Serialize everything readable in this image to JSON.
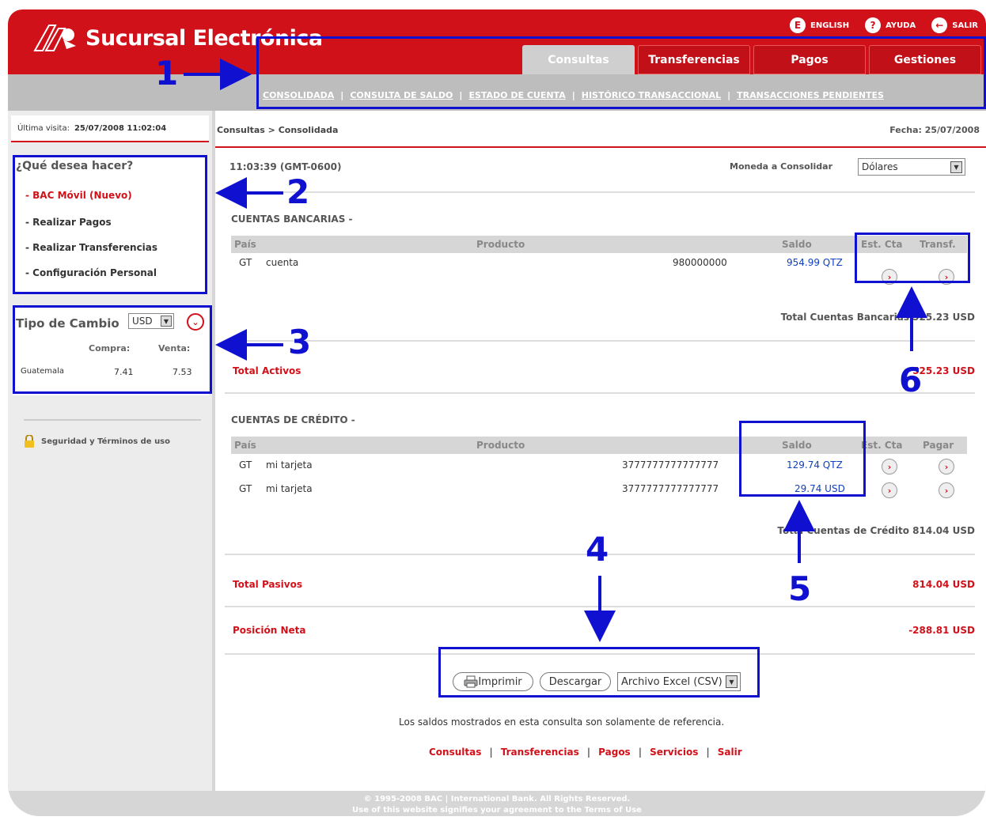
{
  "header": {
    "brand": "Sucursal Electrónica",
    "toplinks": [
      {
        "icon": "globe-icon",
        "glyph": "E",
        "label": "ENGLISH"
      },
      {
        "icon": "help-icon",
        "glyph": "?",
        "label": "AYUDA"
      },
      {
        "icon": "exit-icon",
        "glyph": "←",
        "label": "SALIR"
      }
    ],
    "tabs": [
      "Consultas",
      "Transferencias",
      "Pagos",
      "Gestiones"
    ],
    "sublinks": [
      "CONSOLIDADA",
      "CONSULTA DE SALDO",
      "ESTADO DE CUENTA",
      "HISTÓRICO TRANSACCIONAL",
      "TRANSACCIONES PENDIENTES"
    ]
  },
  "sidebar": {
    "last_visit_label": "Última visita:",
    "last_visit_value": "25/07/2008 11:02:04",
    "question": "¿Qué desea hacer?",
    "items": [
      "- BAC Móvil (Nuevo)",
      "- Realizar Pagos",
      "- Realizar Transferencias",
      "- Configuración Personal"
    ],
    "exchange": {
      "title": "Tipo de Cambio",
      "currency": "USD",
      "compra_label": "Compra:",
      "venta_label": "Venta:",
      "country": "Guatemala",
      "compra": "7.41",
      "venta": "7.53"
    },
    "security": "Seguridad y Términos de uso"
  },
  "main": {
    "breadcrumb": "Consultas > Consolidada",
    "fecha": "Fecha: 25/07/2008",
    "time": "11:03:39 (GMT-0600)",
    "moneda_label": "Moneda a Consolidar",
    "moneda_value": "Dólares",
    "bancarias": {
      "title": "CUENTAS BANCARIAS -",
      "headers": [
        "País",
        "Producto",
        "Saldo",
        "Est. Cta",
        "Transf."
      ],
      "row": {
        "pais": "GT",
        "producto": "cuenta",
        "numero": "980000000",
        "saldo": "954.99 QTZ"
      },
      "total": "Total Cuentas Bancarias 525.23 USD"
    },
    "total_activos_label": "Total Activos",
    "total_activos_value": "525.23 USD",
    "credito": {
      "title": "CUENTAS DE CRÉDITO -",
      "headers": [
        "País",
        "Producto",
        "Saldo",
        "Est. Cta",
        "Pagar"
      ],
      "rows": [
        {
          "pais": "GT",
          "producto": "mi tarjeta",
          "numero": "3777777777777777",
          "saldo": "129.74 QTZ"
        },
        {
          "pais": "GT",
          "producto": "mi tarjeta",
          "numero": "3777777777777777",
          "saldo": "29.74 USD"
        }
      ],
      "total": "Total Cuentas de Crédito 814.04 USD"
    },
    "total_pasivos_label": "Total Pasivos",
    "total_pasivos_value": "814.04 USD",
    "posicion_label": "Posición Neta",
    "posicion_value": "-288.81 USD",
    "imprimir": "Imprimir",
    "descargar": "Descargar",
    "formato": "Archivo Excel (CSV)",
    "note": "Los saldos mostrados en esta consulta son solamente de referencia.",
    "footer_links": [
      "Consultas",
      "Transferencias",
      "Pagos",
      "Servicios",
      "Salir"
    ]
  },
  "footer": {
    "line1": "© 1995-2008 BAC | International Bank. All Rights Reserved.",
    "line2": "Use of this website signifies your agreement to the Terms of Use"
  },
  "annotations": {
    "n1": "1",
    "n2": "2",
    "n3": "3",
    "n4": "4",
    "n5": "5",
    "n6": "6",
    "color": "#1010d0"
  }
}
